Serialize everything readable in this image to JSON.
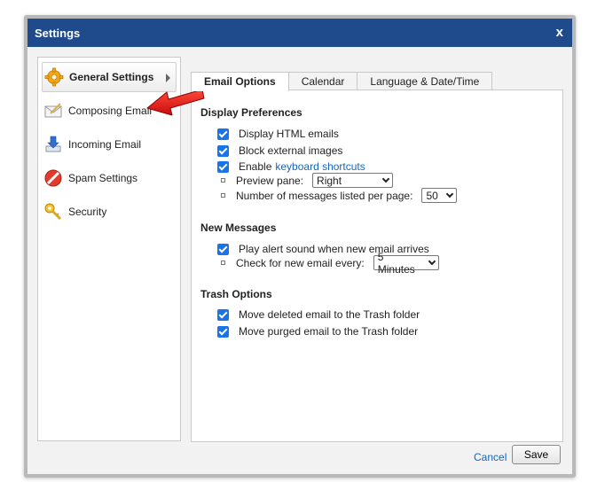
{
  "window": {
    "title": "Settings",
    "close_glyph": "x"
  },
  "sidebar": {
    "items": [
      {
        "label": "General Settings",
        "icon": "gear-icon",
        "active": true
      },
      {
        "label": "Composing Email",
        "icon": "envelope-icon"
      },
      {
        "label": "Incoming Email",
        "icon": "download-arrow-icon"
      },
      {
        "label": "Spam Settings",
        "icon": "no-entry-icon"
      },
      {
        "label": "Security",
        "icon": "key-icon"
      }
    ]
  },
  "tabs": [
    {
      "label": "Email Options",
      "active": true
    },
    {
      "label": "Calendar"
    },
    {
      "label": "Language & Date/Time"
    }
  ],
  "display_preferences": {
    "title": "Display Preferences",
    "display_html": "Display HTML emails",
    "block_images": "Block external images",
    "enable_prefix": "Enable",
    "enable_link": "keyboard shortcuts",
    "preview_pane_label": "Preview pane:",
    "preview_pane_value": "Right",
    "messages_per_page_label": "Number of messages listed per page:",
    "messages_per_page_value": "50"
  },
  "new_messages": {
    "title": "New Messages",
    "alert_sound": "Play alert sound when new email arrives",
    "check_label": "Check for new email every:",
    "check_value": "5 Minutes"
  },
  "trash_options": {
    "title": "Trash Options",
    "move_deleted": "Move deleted email to the Trash folder",
    "move_purged": "Move purged email to the Trash folder"
  },
  "footer": {
    "cancel_label": "Cancel",
    "save_label": "Save"
  },
  "colors": {
    "titlebar": "#1f4b8c",
    "checkbox": "#1a73e8",
    "link": "#1565c0",
    "annotation_arrow": "#e02020"
  }
}
